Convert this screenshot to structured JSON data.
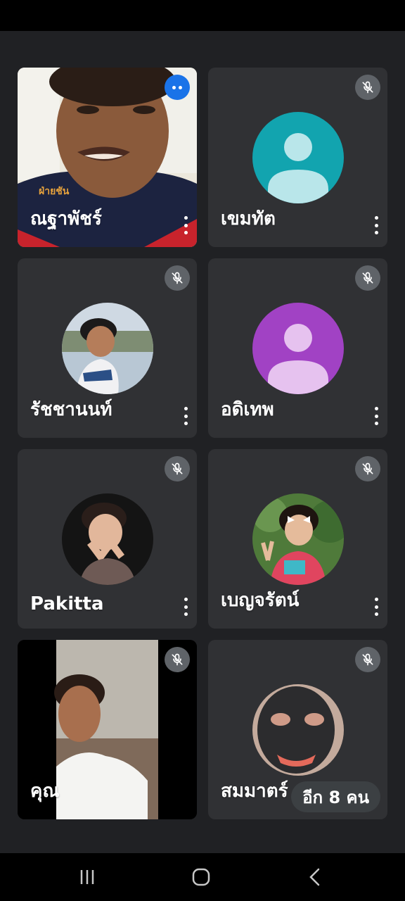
{
  "participants": [
    {
      "name": "ณฐาพัชร์",
      "state": "speaking",
      "video": true
    },
    {
      "name": "เขมทัต",
      "state": "muted",
      "avatar_color": "#12a4af"
    },
    {
      "name": "รัชชานนท์",
      "state": "muted",
      "avatar": "photo"
    },
    {
      "name": "อดิเทพ",
      "state": "muted",
      "avatar_color": "#a142c4"
    },
    {
      "name": "Pakitta",
      "state": "muted",
      "avatar": "photo"
    },
    {
      "name": "เบญจรัตน์",
      "state": "muted",
      "avatar": "photo"
    },
    {
      "name": "คุณ",
      "state": "muted",
      "video": true
    },
    {
      "name": "สมมาตร์",
      "state": "muted",
      "avatar": "photo"
    }
  ],
  "more_participants_label": "อีก 8 คน",
  "icons": {
    "mute": "mic-off-icon",
    "speaking": "audio-wave-icon",
    "more": "more-vert-icon",
    "nav_recent": "recent-apps-icon",
    "nav_home": "home-icon",
    "nav_back": "back-icon"
  }
}
